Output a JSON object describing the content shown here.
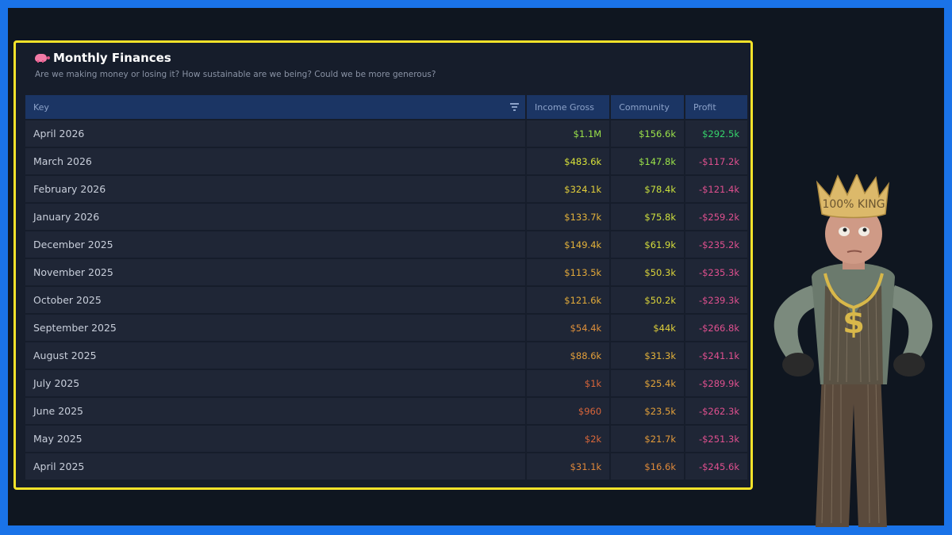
{
  "card": {
    "title": "Monthly Finances",
    "subtitle": "Are we making money or losing it? How sustainable are we being? Could we be more generous?"
  },
  "table": {
    "columns": [
      "Key",
      "Income Gross",
      "Community",
      "Profit"
    ],
    "rows": [
      {
        "key": "April 2026",
        "income": "$1.1M",
        "community": "$156.6k",
        "profit": "$292.5k",
        "income_color": "#9be34a",
        "community_color": "#9be34a",
        "profit_color": "#36d36b"
      },
      {
        "key": "March 2026",
        "income": "$483.6k",
        "community": "$147.8k",
        "profit": "-$117.2k",
        "income_color": "#d8e23a",
        "community_color": "#9be34a",
        "profit_color": "#e0508f"
      },
      {
        "key": "February 2026",
        "income": "$324.1k",
        "community": "$78.4k",
        "profit": "-$121.4k",
        "income_color": "#e3cf3a",
        "community_color": "#c9e03d",
        "profit_color": "#e0508f"
      },
      {
        "key": "January 2026",
        "income": "$133.7k",
        "community": "$75.8k",
        "profit": "-$259.2k",
        "income_color": "#e3b23a",
        "community_color": "#cfe03d",
        "profit_color": "#e0508f"
      },
      {
        "key": "December 2025",
        "income": "$149.4k",
        "community": "$61.9k",
        "profit": "-$235.2k",
        "income_color": "#e3b23a",
        "community_color": "#d6de3b",
        "profit_color": "#e0508f"
      },
      {
        "key": "November 2025",
        "income": "$113.5k",
        "community": "$50.3k",
        "profit": "-$235.3k",
        "income_color": "#e3a93a",
        "community_color": "#dbd43a",
        "profit_color": "#e0508f"
      },
      {
        "key": "October 2025",
        "income": "$121.6k",
        "community": "$50.2k",
        "profit": "-$239.3k",
        "income_color": "#e3ab3a",
        "community_color": "#dbd43a",
        "profit_color": "#e0508f"
      },
      {
        "key": "September 2025",
        "income": "$54.4k",
        "community": "$44k",
        "profit": "-$266.8k",
        "income_color": "#de8f3a",
        "community_color": "#dfcf3a",
        "profit_color": "#e0508f"
      },
      {
        "key": "August 2025",
        "income": "$88.6k",
        "community": "$31.3k",
        "profit": "-$241.1k",
        "income_color": "#e29e3a",
        "community_color": "#e3b23a",
        "profit_color": "#e0508f"
      },
      {
        "key": "July 2025",
        "income": "$1k",
        "community": "$25.4k",
        "profit": "-$289.9k",
        "income_color": "#d9653a",
        "community_color": "#e3a53a",
        "profit_color": "#e0508f"
      },
      {
        "key": "June 2025",
        "income": "$960",
        "community": "$23.5k",
        "profit": "-$262.3k",
        "income_color": "#d9653a",
        "community_color": "#e3a03a",
        "profit_color": "#e0508f"
      },
      {
        "key": "May 2025",
        "income": "$2k",
        "community": "$21.7k",
        "profit": "-$251.3k",
        "income_color": "#d9673a",
        "community_color": "#e39a3a",
        "profit_color": "#e0508f"
      },
      {
        "key": "April 2025",
        "income": "$31.1k",
        "community": "$16.6k",
        "profit": "-$245.6k",
        "income_color": "#df873a",
        "community_color": "#e08a3a",
        "profit_color": "#e0508f"
      }
    ]
  },
  "character": {
    "crown_text": "100% KING"
  },
  "icons": {
    "title_icon": "piggy-bank-icon",
    "filter_icon": "filter-icon"
  },
  "colors": {
    "outer_border": "#1a73e8",
    "card_highlight": "#f5e22a",
    "header_bg": "#1b3564"
  }
}
